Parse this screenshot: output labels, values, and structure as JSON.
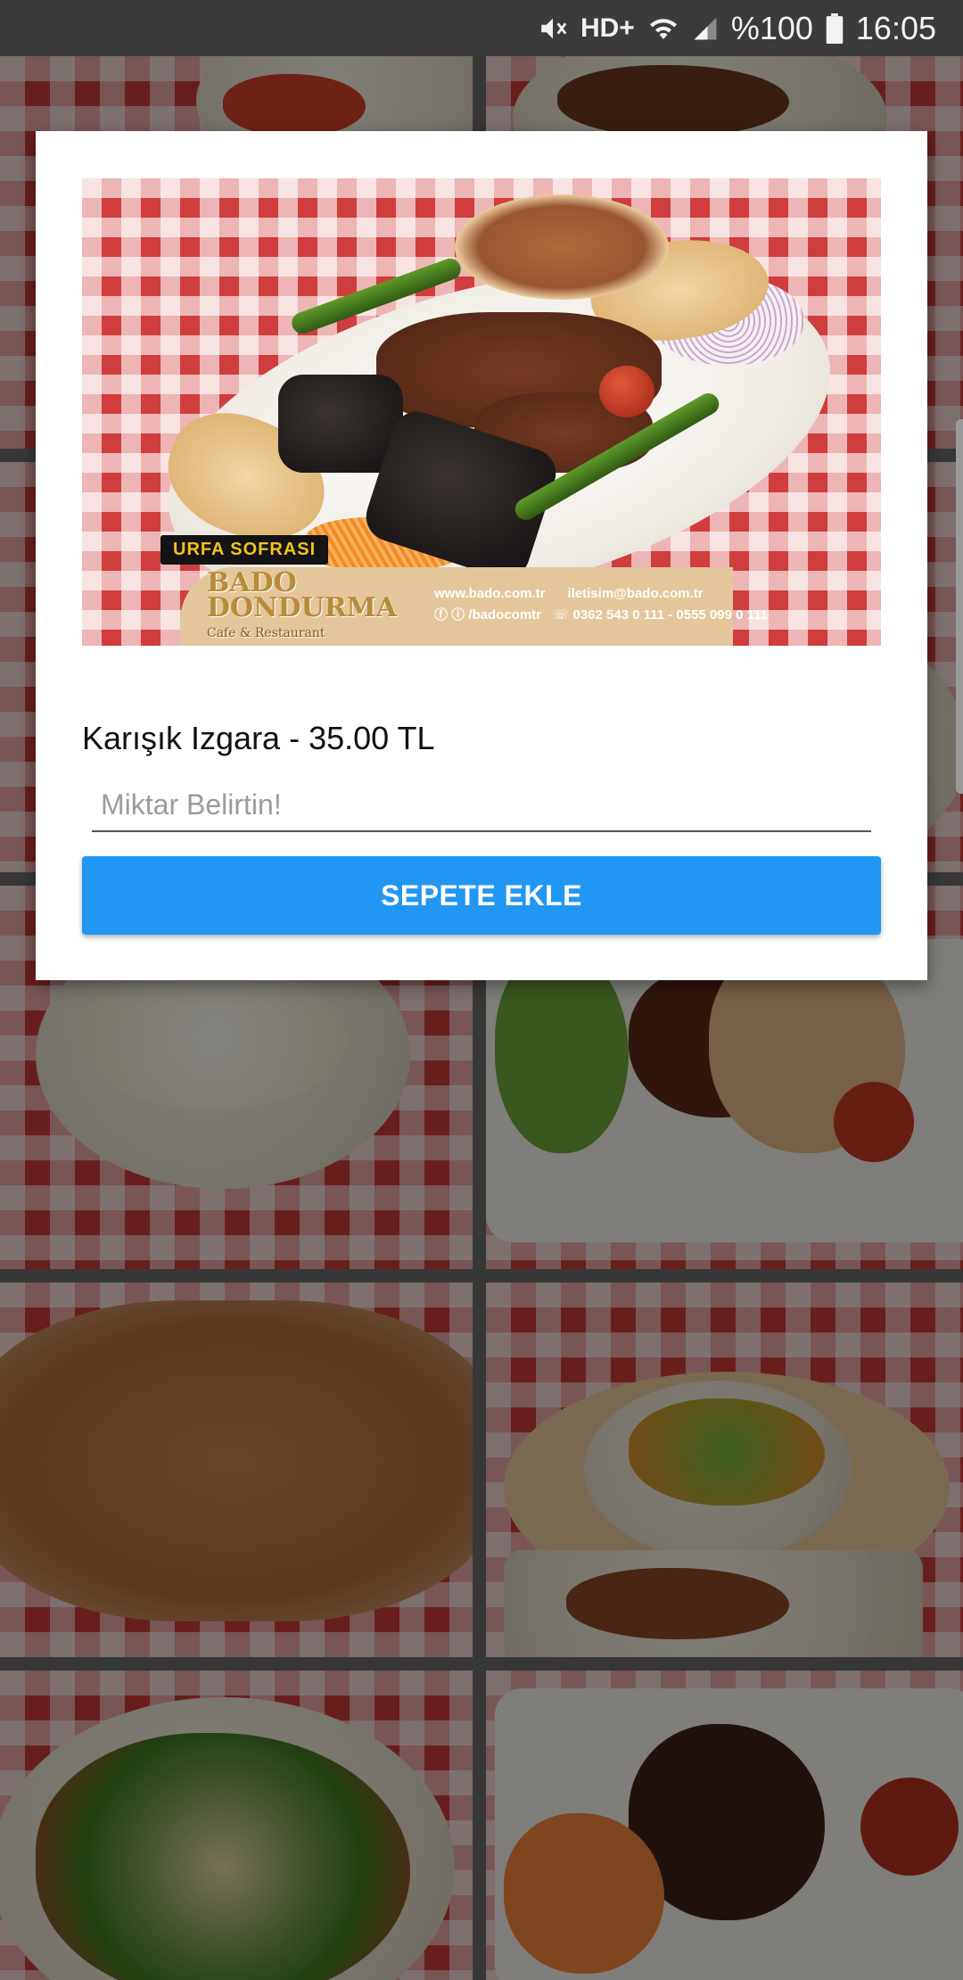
{
  "status_bar": {
    "network_label": "HD+",
    "battery_text": "%100",
    "time": "16:05",
    "icons": [
      "mute-icon",
      "wifi-icon",
      "signal-icon",
      "battery-icon"
    ]
  },
  "dialog": {
    "product_image": {
      "tag": "URFA SOFRASI",
      "brand_line1": "BADO",
      "brand_line2": "DONDURMA",
      "brand_line3": "Cafe & Restaurant",
      "web": "www.bado.com.tr",
      "email": "iletisim@bado.com.tr",
      "social": "/badocomtr",
      "phones": "0362 543 0 111 - 0555 099 0 111"
    },
    "product_title": "Karışık Izgara - 35.00 TL",
    "quantity": {
      "value": "",
      "placeholder": "Miktar Belirtin!"
    },
    "add_button_label": "SEPETE EKLE"
  },
  "colors": {
    "accent": "#2196F3",
    "status_bar": "#3B3B3B",
    "dialog_bg": "#FFFFFF"
  }
}
